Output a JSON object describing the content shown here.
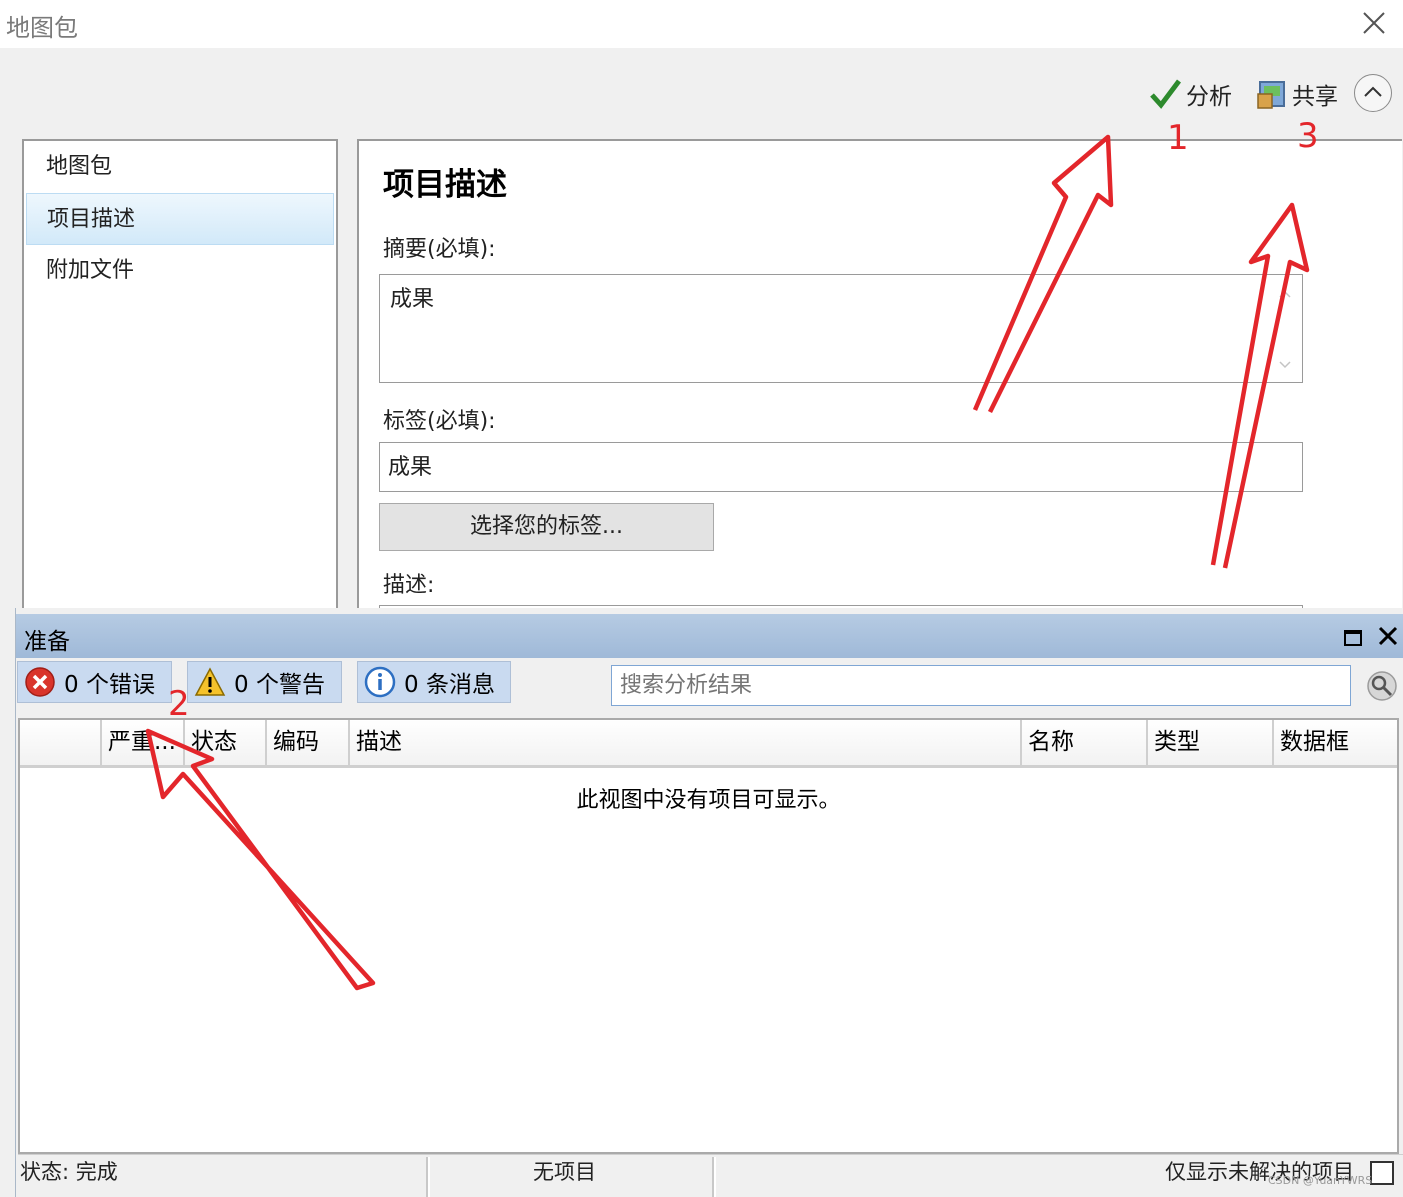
{
  "window": {
    "title": "地图包"
  },
  "toolbar": {
    "analyze_label": "分析",
    "share_label": "共享"
  },
  "nav": {
    "items": [
      {
        "label": "地图包",
        "selected": false
      },
      {
        "label": "项目描述",
        "selected": true
      },
      {
        "label": "附加文件",
        "selected": false
      }
    ]
  },
  "content": {
    "heading": "项目描述",
    "summary_label": "摘要(必填):",
    "summary_value": "成果",
    "tags_label": "标签(必填):",
    "tags_value": "成果",
    "choose_tags_button": "选择您的标签...",
    "description_label": "描述:"
  },
  "panel": {
    "title": "准备",
    "errors_label": "0 个错误",
    "warnings_label": "0 个警告",
    "messages_label": "0 条消息",
    "search_placeholder": "搜索分析结果",
    "columns": [
      "严重...",
      "状态",
      "编码",
      "描述",
      "名称",
      "类型",
      "数据框"
    ],
    "empty_message": "此视图中没有项目可显示。",
    "status_text": "状态: 完成",
    "items_text": "无项目",
    "unresolved_text": "仅显示未解决的项目"
  },
  "annotations": {
    "labels": [
      "1",
      "2",
      "3"
    ],
    "color": "#e3262b"
  },
  "watermark": "CSDN @YuanYWRS",
  "colors": {
    "accent": "#9fb9d8",
    "filter_button": "#c9daf0",
    "annotation": "#e3262b"
  }
}
